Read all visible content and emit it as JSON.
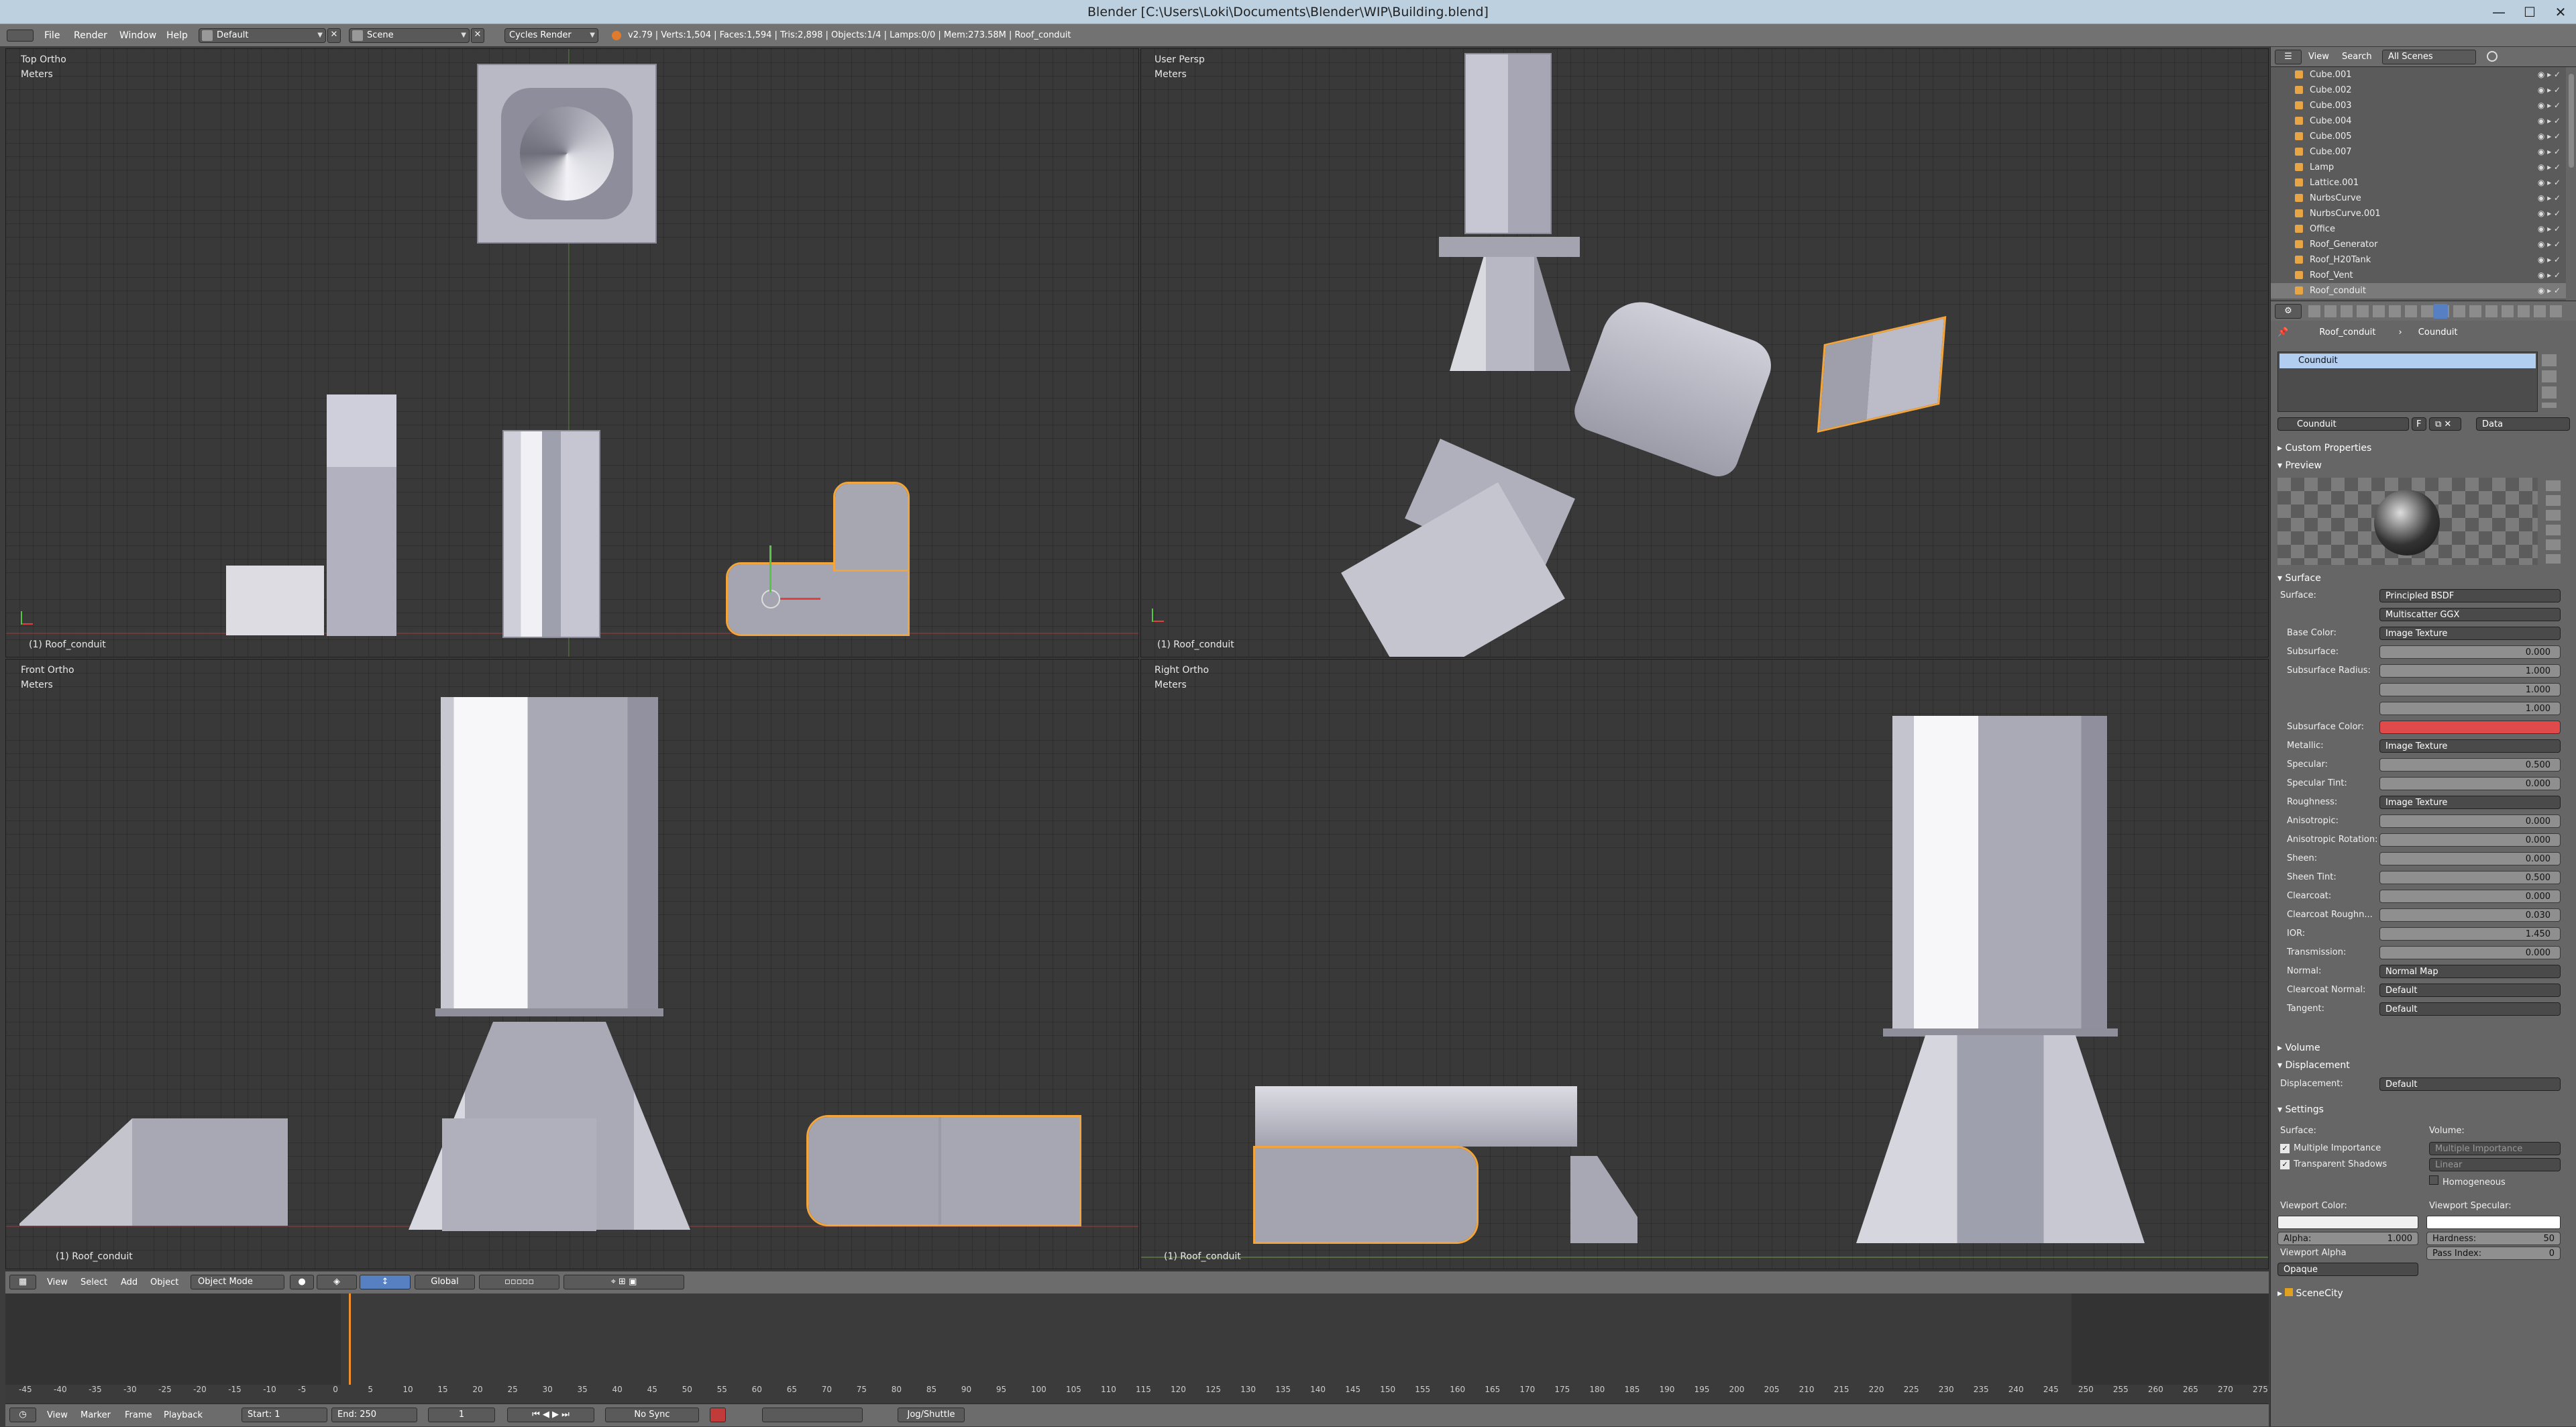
{
  "window": {
    "title": "Blender [C:\\Users\\Loki\\Documents\\Blender\\WIP\\Building.blend]",
    "minimize": "—",
    "maximize": "☐",
    "close": "✕"
  },
  "topbar": {
    "menus": [
      "File",
      "Render",
      "Window",
      "Help"
    ],
    "layout": "Default",
    "scene": "Scene",
    "engine": "Cycles Render",
    "stats": "v2.79 | Verts:1,504 | Faces:1,594 | Tris:2,898 | Objects:1/4 | Lamps:0/0 | Mem:273.58M | Roof_conduit"
  },
  "viewports": [
    {
      "view": "Top Ortho",
      "units": "Meters",
      "object": "(1) Roof_conduit"
    },
    {
      "view": "User Persp",
      "units": "Meters",
      "object": "(1) Roof_conduit"
    },
    {
      "view": "Front Ortho",
      "units": "Meters",
      "object": "(1) Roof_conduit"
    },
    {
      "view": "Right Ortho",
      "units": "Meters",
      "object": "(1) Roof_conduit"
    }
  ],
  "view3d_header": {
    "menus": [
      "View",
      "Select",
      "Add",
      "Object"
    ],
    "mode": "Object Mode",
    "orientation": "Global"
  },
  "timeline": {
    "menus": [
      "View",
      "Marker",
      "Frame",
      "Playback"
    ],
    "start_label": "Start:",
    "start": "1",
    "end_label": "End:",
    "end": "250",
    "current": "1",
    "sync": "No Sync",
    "keying": "Jog/Shuttle",
    "ruler": [
      "-45",
      "-40",
      "-35",
      "-30",
      "-25",
      "-20",
      "-15",
      "-10",
      "-5",
      "0",
      "5",
      "10",
      "15",
      "20",
      "25",
      "30",
      "35",
      "40",
      "45",
      "50",
      "55",
      "60",
      "65",
      "70",
      "75",
      "80",
      "85",
      "90",
      "95",
      "100",
      "105",
      "110",
      "115",
      "120",
      "125",
      "130",
      "135",
      "140",
      "145",
      "150",
      "155",
      "160",
      "165",
      "170",
      "175",
      "180",
      "185",
      "190",
      "195",
      "200",
      "205",
      "210",
      "215",
      "220",
      "225",
      "230",
      "235",
      "240",
      "245",
      "250",
      "255",
      "260",
      "265",
      "270",
      "275"
    ]
  },
  "outliner": {
    "menus": [
      "View",
      "Search"
    ],
    "scenes": "All Scenes",
    "items": [
      "Cube.001",
      "Cube.002",
      "Cube.003",
      "Cube.004",
      "Cube.005",
      "Cube.007",
      "Lamp",
      "Lattice.001",
      "NurbsCurve",
      "NurbsCurve.001",
      "Office",
      "Roof_Generator",
      "Roof_H20Tank",
      "Roof_Vent",
      "Roof_conduit"
    ]
  },
  "properties": {
    "breadcrumb_object": "Roof_conduit",
    "breadcrumb_material": "Counduit",
    "slot": "Counduit",
    "material_name": "Counduit",
    "fake_user": "F",
    "link": "Data",
    "custom_properties": "Custom Properties",
    "preview": "Preview",
    "surface_section": "Surface",
    "surface_label": "Surface:",
    "surface_value": "Principled BSDF",
    "distribution": "Multiscatter GGX",
    "params": [
      {
        "label": "Base Color:",
        "kind": "link",
        "value": "Image Texture"
      },
      {
        "label": "Subsurface:",
        "kind": "num",
        "value": "0.000"
      },
      {
        "label": "Subsurface Radius:",
        "kind": "num",
        "value": "1.000"
      },
      {
        "label": "",
        "kind": "num",
        "value": "1.000"
      },
      {
        "label": "",
        "kind": "num",
        "value": "1.000"
      },
      {
        "label": "Subsurface Color:",
        "kind": "color",
        "value": ""
      },
      {
        "label": "Metallic:",
        "kind": "link",
        "value": "Image Texture"
      },
      {
        "label": "Specular:",
        "kind": "num",
        "value": "0.500"
      },
      {
        "label": "Specular Tint:",
        "kind": "num",
        "value": "0.000"
      },
      {
        "label": "Roughness:",
        "kind": "link",
        "value": "Image Texture"
      },
      {
        "label": "Anisotropic:",
        "kind": "num",
        "value": "0.000"
      },
      {
        "label": "Anisotropic Rotation:",
        "kind": "num",
        "value": "0.000"
      },
      {
        "label": "Sheen:",
        "kind": "num",
        "value": "0.000"
      },
      {
        "label": "Sheen Tint:",
        "kind": "num",
        "value": "0.500"
      },
      {
        "label": "Clearcoat:",
        "kind": "num",
        "value": "0.000"
      },
      {
        "label": "Clearcoat Roughn...",
        "kind": "num",
        "value": "0.030"
      },
      {
        "label": "IOR:",
        "kind": "num",
        "value": "1.450"
      },
      {
        "label": "Transmission:",
        "kind": "num",
        "value": "0.000"
      },
      {
        "label": "Normal:",
        "kind": "link",
        "value": "Normal Map"
      },
      {
        "label": "Clearcoat Normal:",
        "kind": "link",
        "value": "Default"
      },
      {
        "label": "Tangent:",
        "kind": "link",
        "value": "Default"
      }
    ],
    "subsurface_color_hex": "#e04a4a",
    "volume": "Volume",
    "displacement_section": "Displacement",
    "displacement_label": "Displacement:",
    "displacement_value": "Default",
    "settings": "Settings",
    "settings_surface": "Surface:",
    "settings_volume": "Volume:",
    "multiple_importance": "Multiple Importance",
    "transparent_shadows": "Transparent Shadows",
    "vol_sampling": "Multiple Importance",
    "vol_interp": "Linear",
    "homogeneous": "Homogeneous",
    "viewport_color": "Viewport Color:",
    "viewport_specular": "Viewport Specular:",
    "alpha_label": "Alpha:",
    "alpha": "1.000",
    "hardness_label": "Hardness:",
    "hardness": "50",
    "viewport_alpha": "Viewport Alpha",
    "pass_index_label": "Pass Index:",
    "pass_index": "0",
    "blend": "Opaque",
    "scene_city": "SceneCity"
  },
  "colors": {
    "accent_select": "#f2a53c",
    "field_blue": "#5680c2"
  }
}
